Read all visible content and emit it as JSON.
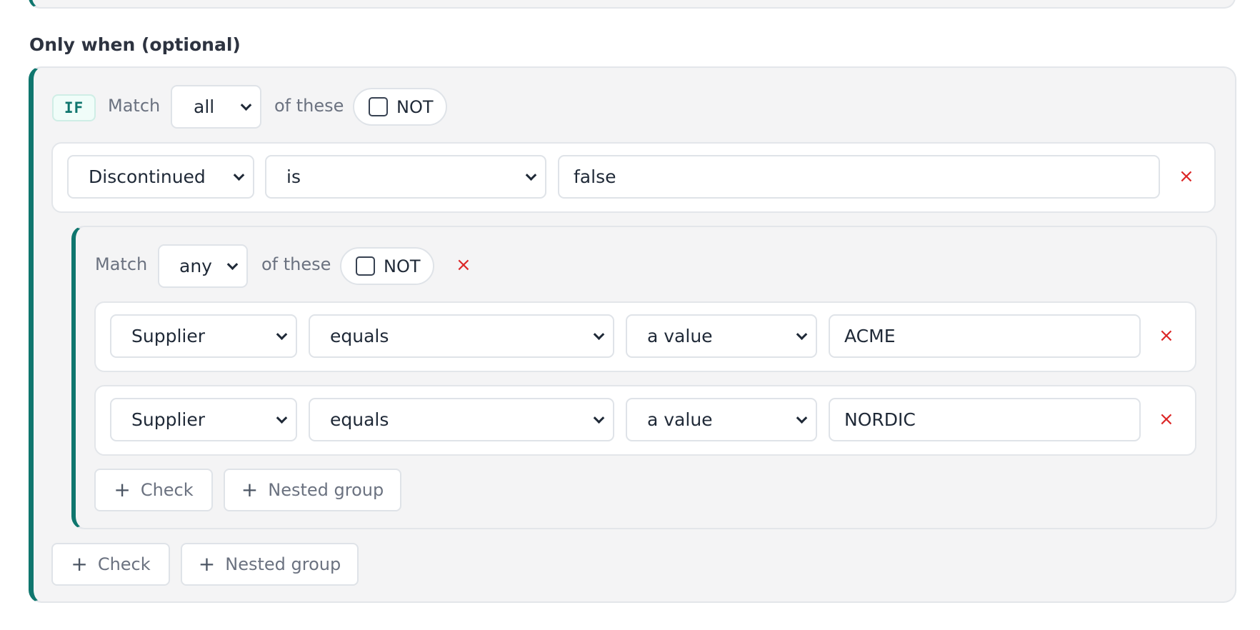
{
  "section": {
    "title": "Only when (optional)"
  },
  "outer_group": {
    "badge": "IF",
    "match_label": "Match",
    "match_value": "all",
    "of_these": "of these",
    "not_label": "NOT",
    "conditions": [
      {
        "field": "Discontinued",
        "operator": "is",
        "value": "false"
      }
    ],
    "add_check": "Check",
    "add_nested": "Nested group"
  },
  "inner_group": {
    "match_label": "Match",
    "match_value": "any",
    "of_these": "of these",
    "not_label": "NOT",
    "conditions": [
      {
        "field": "Supplier",
        "operator": "equals",
        "value_type": "a value",
        "value": "ACME"
      },
      {
        "field": "Supplier",
        "operator": "equals",
        "value_type": "a value",
        "value": "NORDIC"
      }
    ],
    "add_check": "Check",
    "add_nested": "Nested group"
  },
  "icons": {
    "remove": "×",
    "plus": "+"
  },
  "colors": {
    "accent": "#0f766e",
    "danger": "#dc2626",
    "group_bg": "#f4f4f5"
  }
}
